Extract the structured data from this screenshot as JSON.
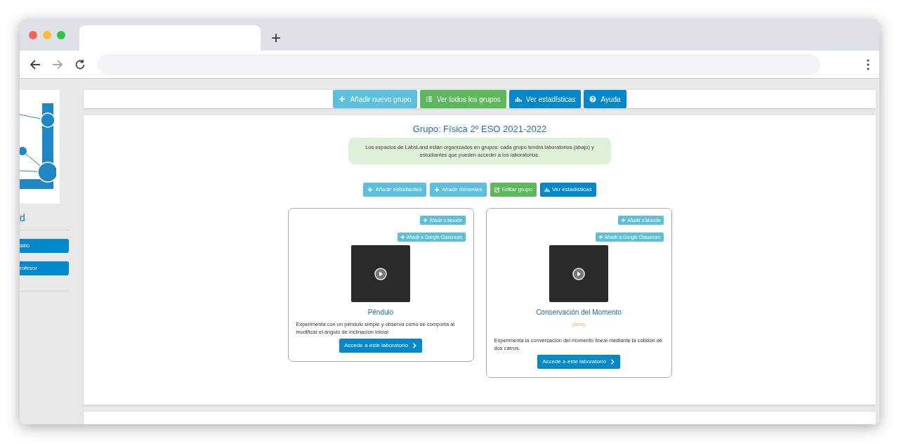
{
  "browser": {
    "new_tab": "+"
  },
  "sidebar": {
    "title": "d",
    "buttons": [
      "sitio",
      "rofesor"
    ]
  },
  "toolbar": [
    {
      "label": "Añadir nuevo grupo",
      "kind": "info"
    },
    {
      "label": "Ver todos los grupos",
      "kind": "success"
    },
    {
      "label": "Ver estadísticas",
      "kind": "primary"
    },
    {
      "label": "Ayuda",
      "kind": "primary"
    }
  ],
  "group": {
    "title": "Grupo: Física 2º ESO 2021-2022",
    "notice": "Los espacios de LabsLand están organizados en grupos: cada grupo tendrá laboratorios (abajo) y estudiantes que pueden acceder a los laboratorios.",
    "actions": [
      {
        "label": "Añadir estudiantes",
        "kind": "info"
      },
      {
        "label": "Añadir docentes",
        "kind": "info"
      },
      {
        "label": "Editar grupo",
        "kind": "success"
      },
      {
        "label": "Ver estadísticas",
        "kind": "primary"
      }
    ],
    "labs": [
      {
        "links": [
          "Añadir a Moodle",
          "Añadir a Google Classroom"
        ],
        "name": "Péndulo",
        "description": "Experimenta con un péndulo simple y observa cómo se comporta al modificar el ángulo de inclinación inicial",
        "button": "Accede a este laboratorio"
      },
      {
        "links": [
          "Añadir a Moodle",
          "Añadir a Google Classroom"
        ],
        "name": "Conservación del Momento",
        "tag": "(beta)",
        "description": "Experimenta la conversación del momento lineal mediante la colisión de dos carros.",
        "button": "Accede a este laboratorio"
      }
    ]
  }
}
